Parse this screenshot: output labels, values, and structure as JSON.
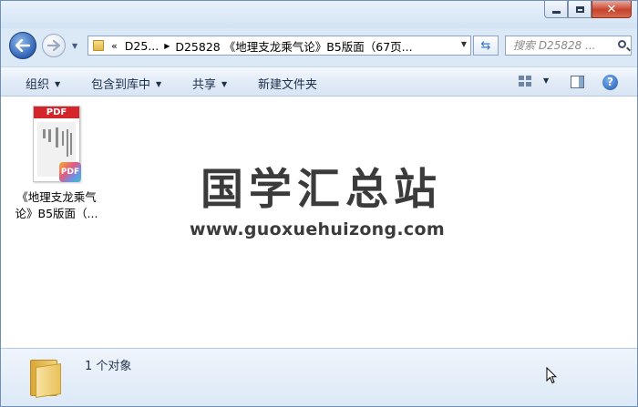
{
  "window": {
    "buttons": {
      "minimize": "",
      "maximize": "",
      "close": "✕"
    }
  },
  "address_bar": {
    "chevron": "«",
    "crumbs": [
      "D25...",
      "D25828 《地理支龙乘气论》B5版面（67页..."
    ],
    "search_placeholder": "搜索 D25828 ..."
  },
  "toolbar": {
    "organize": "组织",
    "include_in_library": "包含到库中",
    "share": "共享",
    "new_folder": "新建文件夹"
  },
  "files": [
    {
      "thumb_band": "PDF",
      "badge": "PDF",
      "label_line1": "《地理支龙乘气",
      "label_line2": "论》B5版面（..."
    }
  ],
  "watermark": {
    "title": "国学汇总站",
    "url": "www.guoxuehuizong.com"
  },
  "details": {
    "count_text": "1 个对象"
  },
  "colors": {
    "pdf_red": "#d4262a",
    "watermark": "#3b3b3b",
    "close_button": "#c8432c"
  }
}
